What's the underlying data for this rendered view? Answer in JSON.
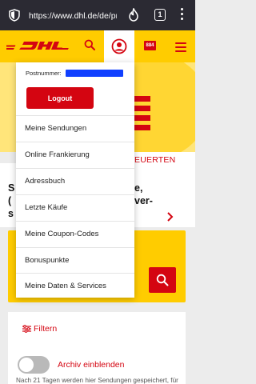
{
  "browser": {
    "url": "https://www.dhl.de/de/pr",
    "tab_count": "1"
  },
  "header": {
    "logo_alt": "DHL",
    "badge": "884"
  },
  "background": {
    "banner_text": "EUERTEN",
    "frag_1": "S",
    "frag_2": "e,",
    "frag_3": "(",
    "frag_4": "ver-",
    "frag_5": "s",
    "filter_label": "Filtern",
    "archive_label": "Archiv einblenden",
    "archive_note": "Nach 21 Tagen werden hier Sendungen gespeichert, für"
  },
  "dropdown": {
    "postnummer_label": "Postnummer:",
    "logout_label": "Logout",
    "items": [
      {
        "label": "Meine Sendungen"
      },
      {
        "label": "Online Frankierung"
      },
      {
        "label": "Adressbuch"
      },
      {
        "label": "Letzte Käufe"
      },
      {
        "label": "Meine Coupon-Codes"
      },
      {
        "label": "Bonuspunkte"
      },
      {
        "label": "Meine Daten & Services"
      }
    ]
  },
  "colors": {
    "dhl_yellow": "#ffcc00",
    "dhl_red": "#d40511",
    "browser_bar": "#2b2a33",
    "redaction": "#1040ff"
  }
}
